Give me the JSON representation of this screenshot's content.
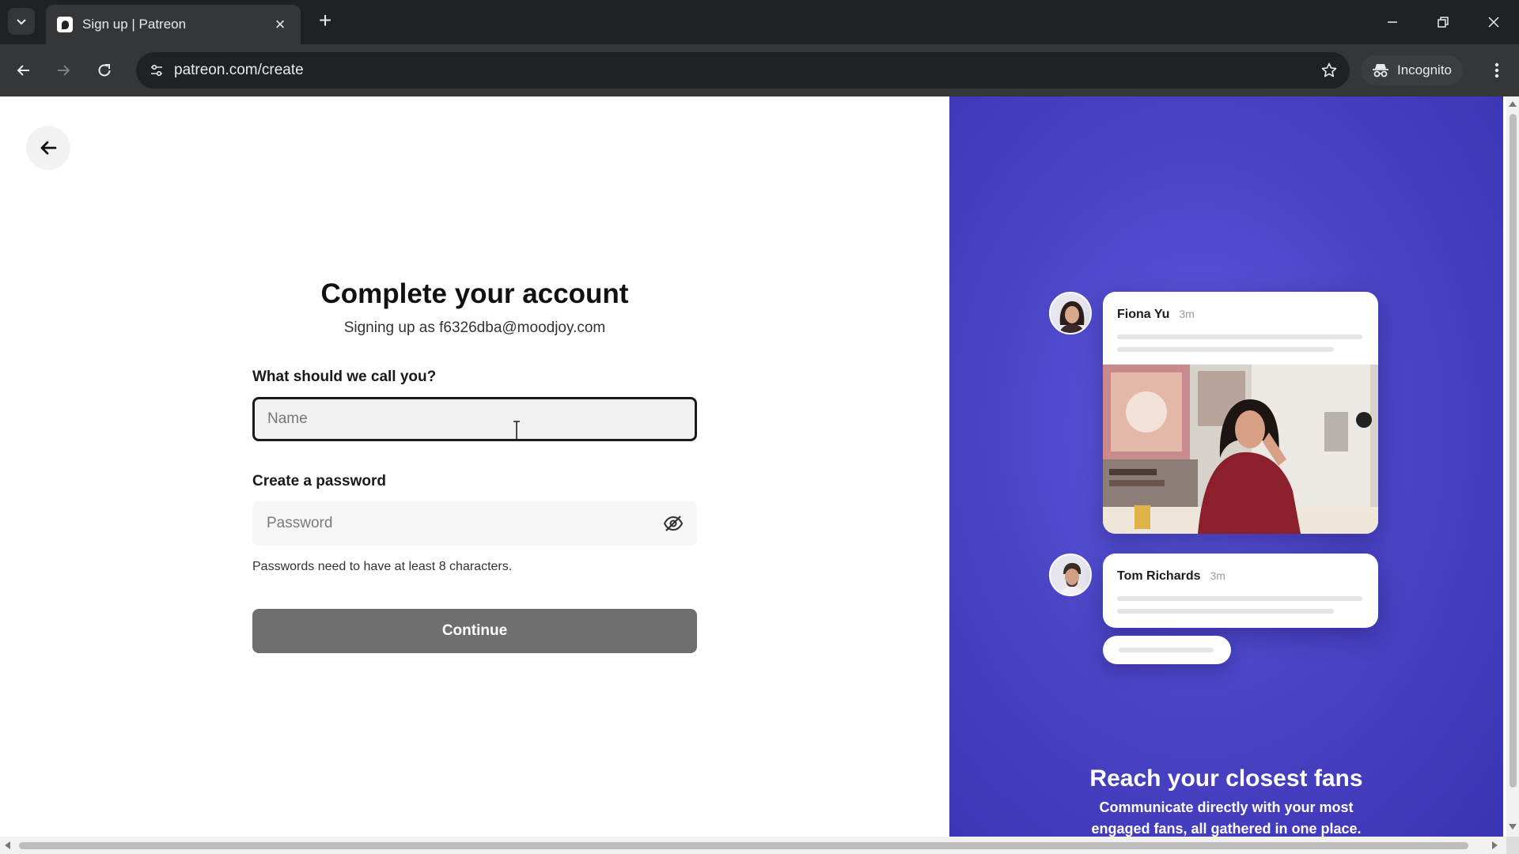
{
  "browser": {
    "tab_title": "Sign up | Patreon",
    "url": "patreon.com/create",
    "incognito_label": "Incognito",
    "icons": {
      "tab_search": "chevron-down-icon",
      "favicon": "patreon-logo-icon",
      "tab_close": "close-icon",
      "new_tab": "plus-icon",
      "back": "arrow-left-icon",
      "forward": "arrow-right-icon",
      "reload": "reload-icon",
      "site_info": "tune-icon",
      "bookmark": "star-icon",
      "incognito": "incognito-icon",
      "menu": "more-vert-icon"
    }
  },
  "page": {
    "back_icon": "arrow-left-icon",
    "title": "Complete your account",
    "subtitle": "Signing up as f6326dba@moodjoy.com",
    "name_field": {
      "label": "What should we call you?",
      "placeholder": "Name",
      "value": ""
    },
    "password_field": {
      "label": "Create a password",
      "placeholder": "Password",
      "value": "",
      "toggle_icon": "eye-off-icon",
      "hint": "Passwords need to have at least 8 characters."
    },
    "continue_label": "Continue"
  },
  "promo": {
    "posts": [
      {
        "author": "Fiona Yu",
        "time": "3m"
      },
      {
        "author": "Tom Richards",
        "time": "3m"
      }
    ],
    "headline": "Reach your closest fans",
    "text": "Communicate directly with your most engaged fans, all gathered in one place."
  },
  "colors": {
    "promo_bg": "#4b45c6",
    "continue_bg": "#6f6f6f",
    "chrome_dark": "#202124",
    "chrome_toolbar": "#35363a"
  }
}
